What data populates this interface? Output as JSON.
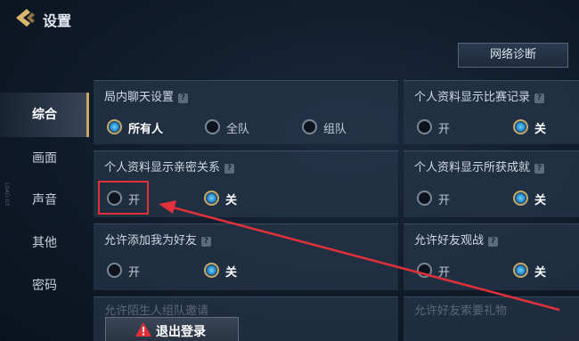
{
  "header": {
    "title": "设置",
    "diag_button": "网络诊断"
  },
  "sidebar": {
    "items": [
      {
        "label": "综合"
      },
      {
        "label": "画面"
      },
      {
        "label": "声音"
      },
      {
        "label": "其他"
      },
      {
        "label": "密码"
      }
    ],
    "vertical_text": "LOAD G5"
  },
  "settings": {
    "chat": {
      "title": "局内聊天设置",
      "opt1": "所有人",
      "opt2": "全队",
      "opt3": "组队",
      "selected": "所有人"
    },
    "match_record": {
      "title": "个人资料显示比赛记录",
      "on": "开",
      "off": "关",
      "selected": "关"
    },
    "intimacy": {
      "title": "个人资料显示亲密关系",
      "on": "开",
      "off": "关",
      "selected": "关"
    },
    "achievement": {
      "title": "个人资料显示所获成就",
      "on": "开",
      "off": "关",
      "selected": "关"
    },
    "add_friend": {
      "title": "允许添加我为好友",
      "on": "开",
      "off": "关",
      "selected": "关"
    },
    "friend_watch": {
      "title": "允许好友观战",
      "on": "开",
      "off": "关",
      "selected": "关"
    },
    "stranger_invite": {
      "title": "允许陌生人组队邀请"
    },
    "friend_gift": {
      "title": "允许好友索要礼物"
    }
  },
  "footer": {
    "logout": "退出登录"
  },
  "colors": {
    "accent": "#c9a863",
    "highlight": "#e0313a",
    "radio_on": "#2d8fcf"
  }
}
